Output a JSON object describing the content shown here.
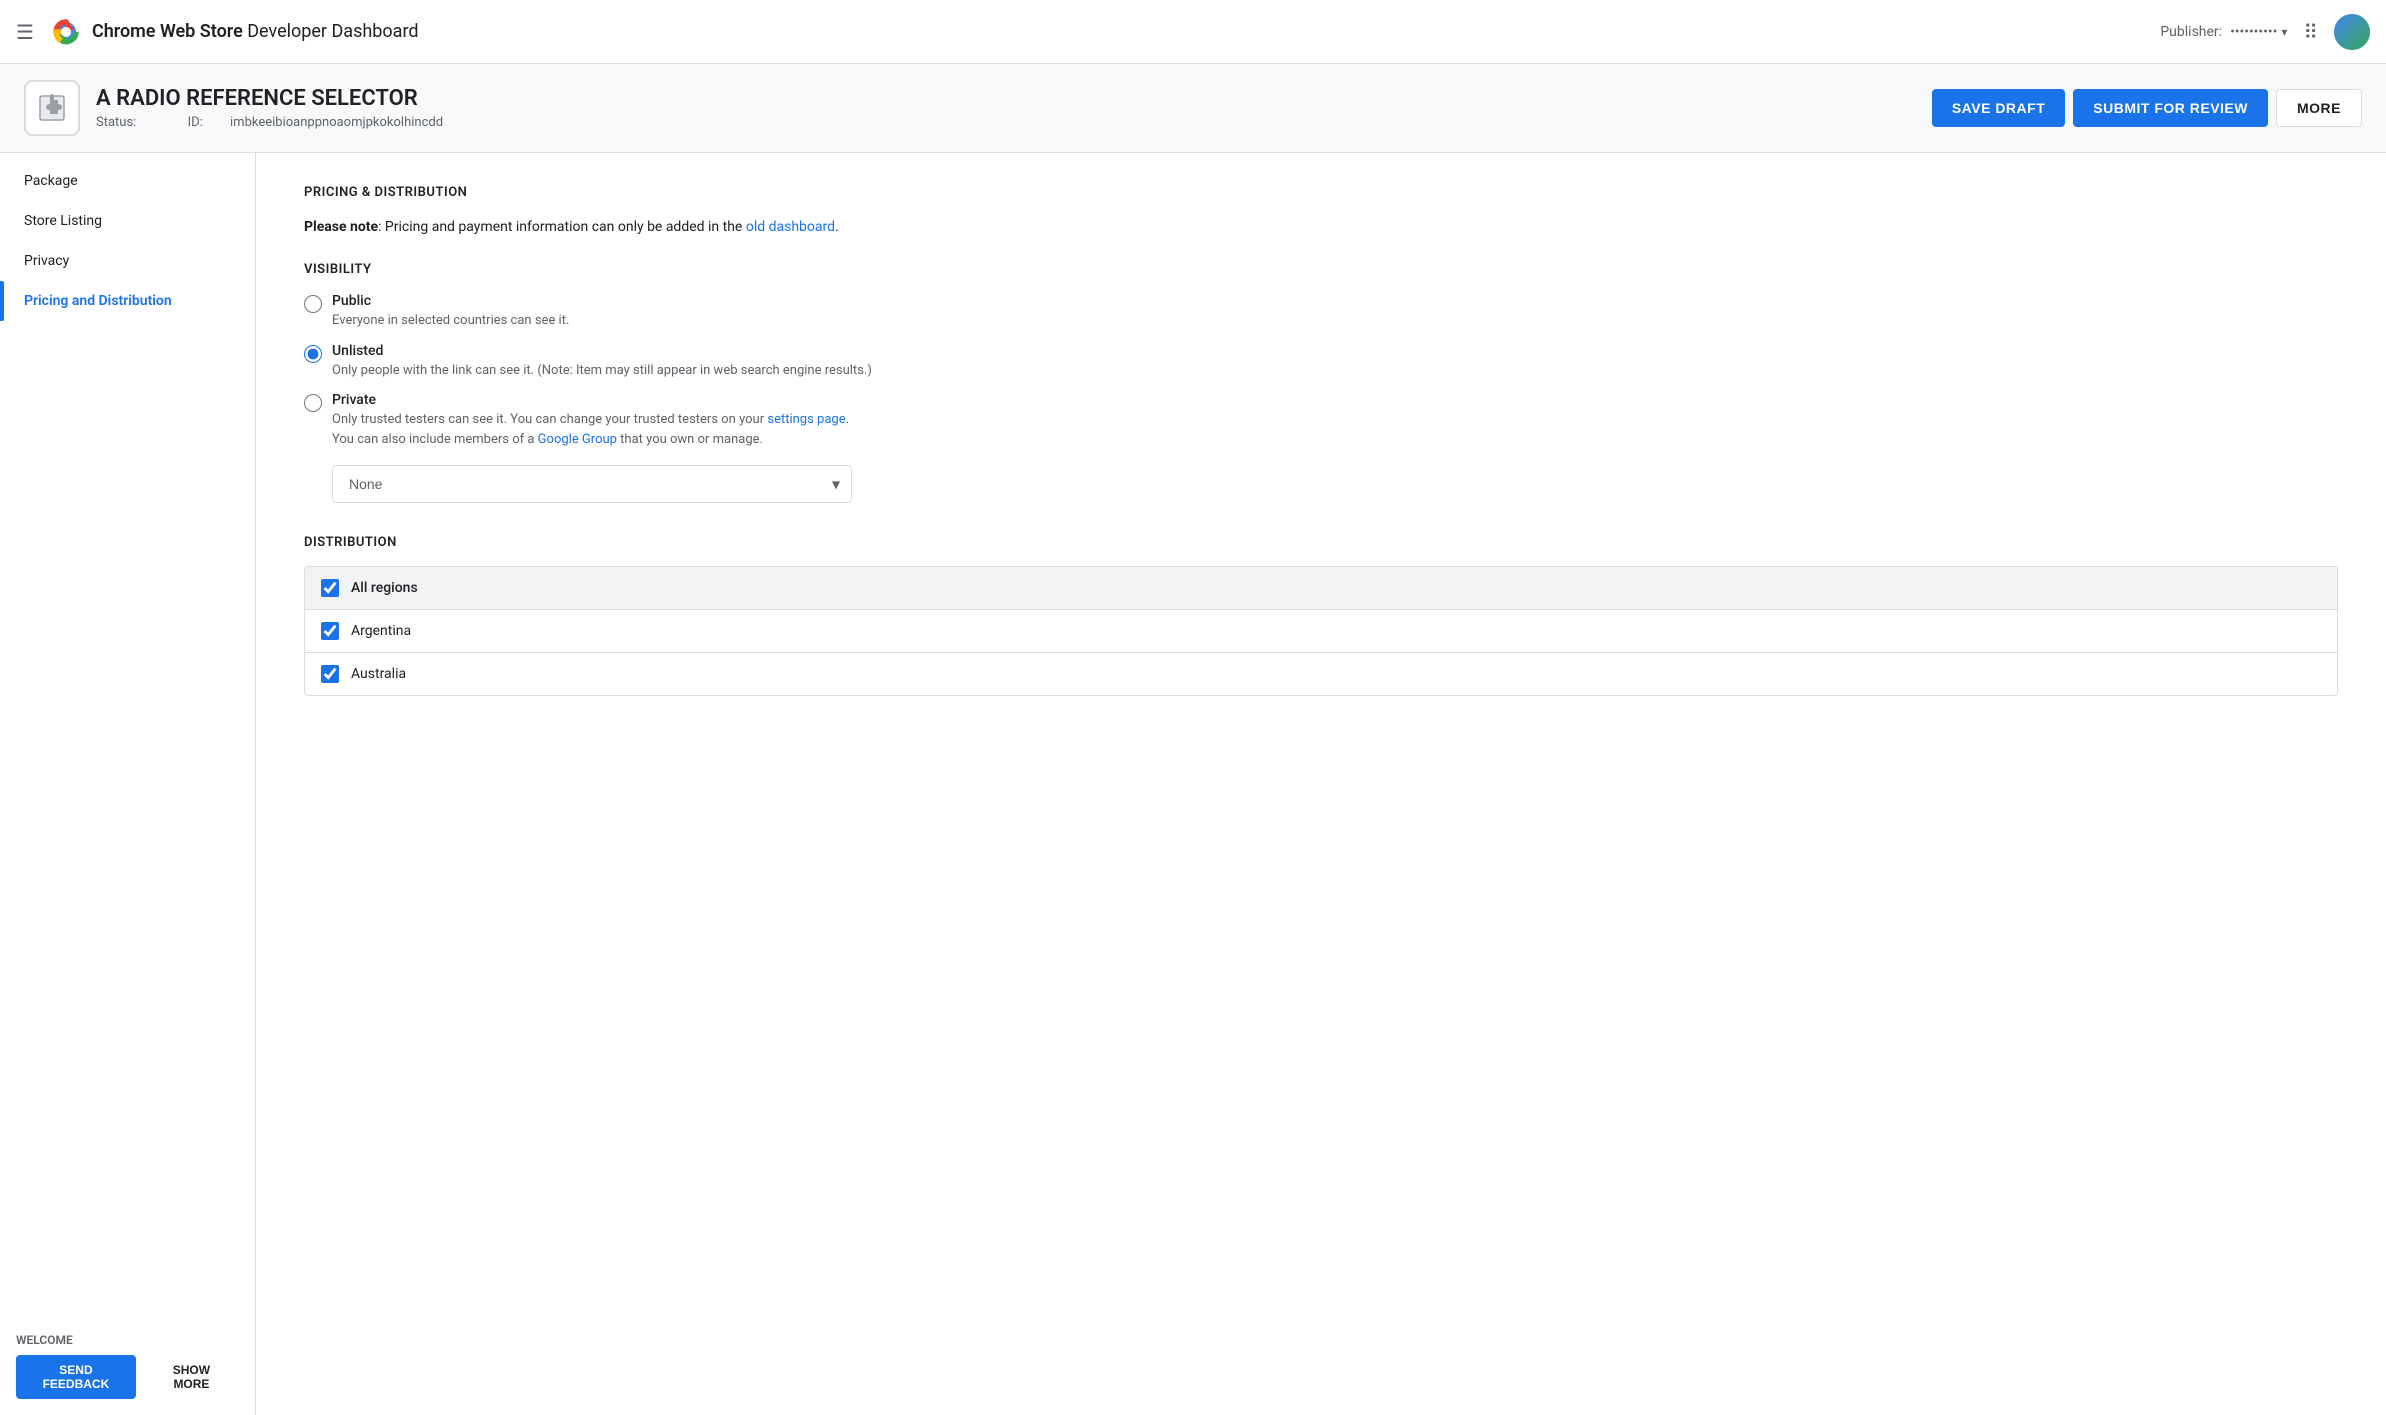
{
  "nav": {
    "hamburger_icon": "☰",
    "title_bold": "Chrome Web Store",
    "title_normal": " Developer Dashboard",
    "publisher_label": "Publisher:",
    "publisher_name": "••••••••••",
    "apps_icon": "⋮⋮⋮",
    "avatar_alt": "User avatar"
  },
  "ext_header": {
    "icon_symbol": "🔧",
    "name": "A RADIO REFERENCE SELECTOR",
    "status_label": "Status:",
    "status_value": "",
    "id_label": "ID:",
    "id_value": "imbkeeibioanppnoaomjpkokolhincdd",
    "save_draft_label": "SAVE DRAFT",
    "submit_label": "SUBMIT FOR REVIEW",
    "more_label": "MORE"
  },
  "sidebar": {
    "items": [
      {
        "label": "Package",
        "active": false
      },
      {
        "label": "Store Listing",
        "active": false
      },
      {
        "label": "Privacy",
        "active": false
      },
      {
        "label": "Pricing and Distribution",
        "active": true
      }
    ],
    "welcome_label": "WELCOME",
    "feedback_label": "SEND FEEDBACK",
    "show_more_label": "SHOW MORE"
  },
  "content": {
    "section_title": "PRICING & DISTRIBUTION",
    "note_bold": "Please note",
    "note_text": ": Pricing and payment information can only be added in the ",
    "note_link_text": "old dashboard",
    "note_period": ".",
    "visibility_title": "VISIBILITY",
    "radios": [
      {
        "id": "public",
        "label": "Public",
        "desc": "Everyone in selected countries can see it.",
        "checked": false
      },
      {
        "id": "unlisted",
        "label": "Unlisted",
        "desc": "Only people with the link can see it. (Note: Item may still appear in web search engine results.)",
        "checked": true
      },
      {
        "id": "private",
        "label": "Private",
        "desc_line1": "Only trusted testers can see it. You can change your trusted testers on your ",
        "desc_link1_text": "settings page",
        "desc_line2": ".",
        "desc_line3": "You can also include members of a ",
        "desc_link2_text": "Google Group",
        "desc_line4": " that you own or manage.",
        "checked": false
      }
    ],
    "group_dropdown_placeholder": "None",
    "distribution_title": "DISTRIBUTION",
    "regions": [
      {
        "label": "All regions",
        "checked": true,
        "is_header": true
      },
      {
        "label": "Argentina",
        "checked": true,
        "is_header": false
      },
      {
        "label": "Australia",
        "checked": true,
        "is_header": false
      }
    ]
  }
}
